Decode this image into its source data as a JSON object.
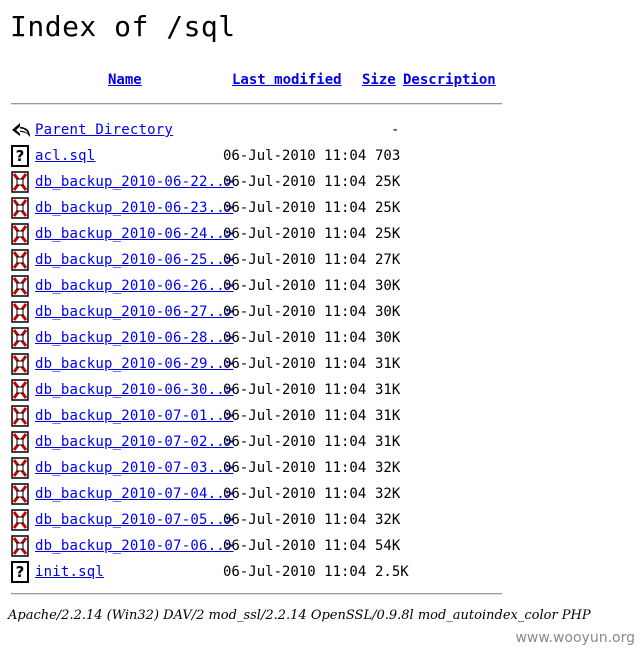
{
  "page": {
    "title": "Index of /sql"
  },
  "columns": {
    "name": "Name",
    "last_modified": "Last modified",
    "size": "Size",
    "description": "Description"
  },
  "parent": {
    "label": "Parent Directory",
    "size": "-",
    "icon": "back-arrow-icon"
  },
  "entries": [
    {
      "name": "acl.sql",
      "modified": "06-Jul-2010 11:04",
      "size": "703",
      "icon": "unknown-file-icon"
    },
    {
      "name": "db_backup_2010-06-22..>",
      "modified": "06-Jul-2010 11:04",
      "size": "25K",
      "icon": "binary-file-icon"
    },
    {
      "name": "db_backup_2010-06-23..>",
      "modified": "06-Jul-2010 11:04",
      "size": "25K",
      "icon": "binary-file-icon"
    },
    {
      "name": "db_backup_2010-06-24..>",
      "modified": "06-Jul-2010 11:04",
      "size": "25K",
      "icon": "binary-file-icon"
    },
    {
      "name": "db_backup_2010-06-25..>",
      "modified": "06-Jul-2010 11:04",
      "size": "27K",
      "icon": "binary-file-icon"
    },
    {
      "name": "db_backup_2010-06-26..>",
      "modified": "06-Jul-2010 11:04",
      "size": "30K",
      "icon": "binary-file-icon"
    },
    {
      "name": "db_backup_2010-06-27..>",
      "modified": "06-Jul-2010 11:04",
      "size": "30K",
      "icon": "binary-file-icon"
    },
    {
      "name": "db_backup_2010-06-28..>",
      "modified": "06-Jul-2010 11:04",
      "size": "30K",
      "icon": "binary-file-icon"
    },
    {
      "name": "db_backup_2010-06-29..>",
      "modified": "06-Jul-2010 11:04",
      "size": "31K",
      "icon": "binary-file-icon"
    },
    {
      "name": "db_backup_2010-06-30..>",
      "modified": "06-Jul-2010 11:04",
      "size": "31K",
      "icon": "binary-file-icon"
    },
    {
      "name": "db_backup_2010-07-01..>",
      "modified": "06-Jul-2010 11:04",
      "size": "31K",
      "icon": "binary-file-icon"
    },
    {
      "name": "db_backup_2010-07-02..>",
      "modified": "06-Jul-2010 11:04",
      "size": "31K",
      "icon": "binary-file-icon"
    },
    {
      "name": "db_backup_2010-07-03..>",
      "modified": "06-Jul-2010 11:04",
      "size": "32K",
      "icon": "binary-file-icon"
    },
    {
      "name": "db_backup_2010-07-04..>",
      "modified": "06-Jul-2010 11:04",
      "size": "32K",
      "icon": "binary-file-icon"
    },
    {
      "name": "db_backup_2010-07-05..>",
      "modified": "06-Jul-2010 11:04",
      "size": "32K",
      "icon": "binary-file-icon"
    },
    {
      "name": "db_backup_2010-07-06..>",
      "modified": "06-Jul-2010 11:04",
      "size": "54K",
      "icon": "binary-file-icon"
    },
    {
      "name": "init.sql",
      "modified": "06-Jul-2010 11:04",
      "size": "2.5K",
      "icon": "unknown-file-icon"
    }
  ],
  "footer": {
    "text": "Apache/2.2.14 (Win32) DAV/2 mod_ssl/2.2.14 OpenSSL/0.9.8l mod_autoindex_color PHP"
  },
  "watermark": {
    "text": "www.wooyun.org"
  },
  "colors": {
    "link": "#0000ee",
    "rule": "#9a9a9a",
    "binary_icon_red": "#cc0000"
  }
}
